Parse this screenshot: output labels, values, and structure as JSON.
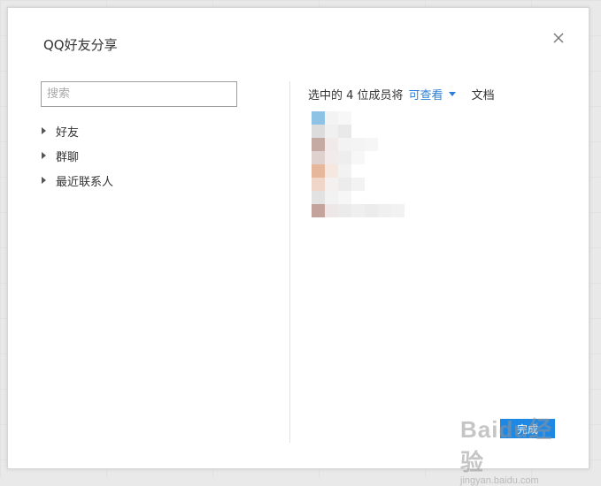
{
  "dialog": {
    "title": "QQ好友分享",
    "close_icon": "close-icon"
  },
  "search": {
    "placeholder": "搜索",
    "value": ""
  },
  "tree": {
    "items": [
      {
        "label": "好友"
      },
      {
        "label": "群聊"
      },
      {
        "label": "最近联系人"
      }
    ]
  },
  "permission": {
    "prefix": "选中的 4 位成员将",
    "selected": "可查看",
    "suffix": "文档"
  },
  "confirm": {
    "label": "完成"
  },
  "watermark": {
    "logo": "Baidu经验",
    "url": "jingyan.baidu.com"
  },
  "colors": {
    "accent": "#2b7fd8",
    "button": "#1e88e5"
  }
}
